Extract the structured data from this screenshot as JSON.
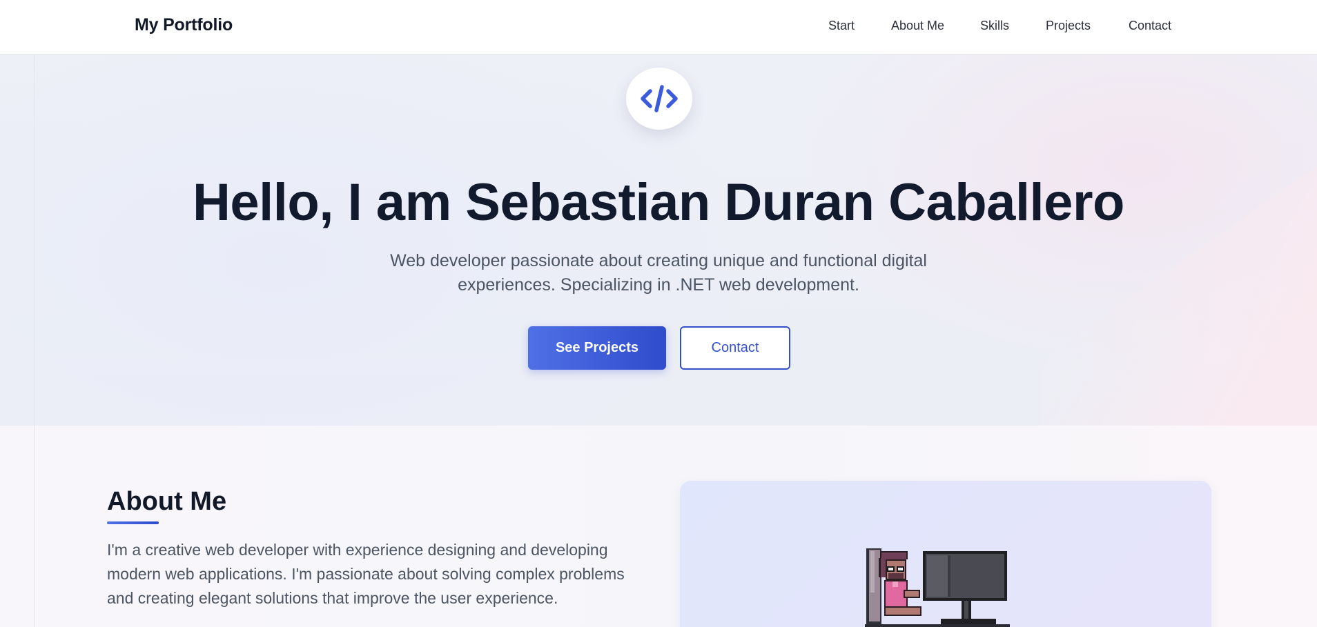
{
  "navbar": {
    "brand": "My Portfolio",
    "links": [
      "Start",
      "About Me",
      "Skills",
      "Projects",
      "Contact"
    ]
  },
  "hero": {
    "badge_icon": "code-icon",
    "title": "Hello, I am Sebastian Duran Caballero",
    "subtitle_line1": "Web developer passionate about creating unique and functional digital",
    "subtitle_line2": "experiences. Specializing in .NET web development.",
    "primary_button": "See Projects",
    "secondary_button": "Contact"
  },
  "about": {
    "title": "About Me",
    "text": "I'm a creative web developer with experience designing and developing modern web applications. I'm passionate about solving complex problems and creating elegant solutions that improve the user experience.",
    "illustration_icon": "pixel-developer-at-computer-icon"
  },
  "colors": {
    "accent": "#3551c9",
    "accent_gradient_start": "#4f70e6",
    "accent_gradient_end": "#2f4ccc",
    "heading": "#121a2e",
    "body_text": "#4b5563"
  }
}
